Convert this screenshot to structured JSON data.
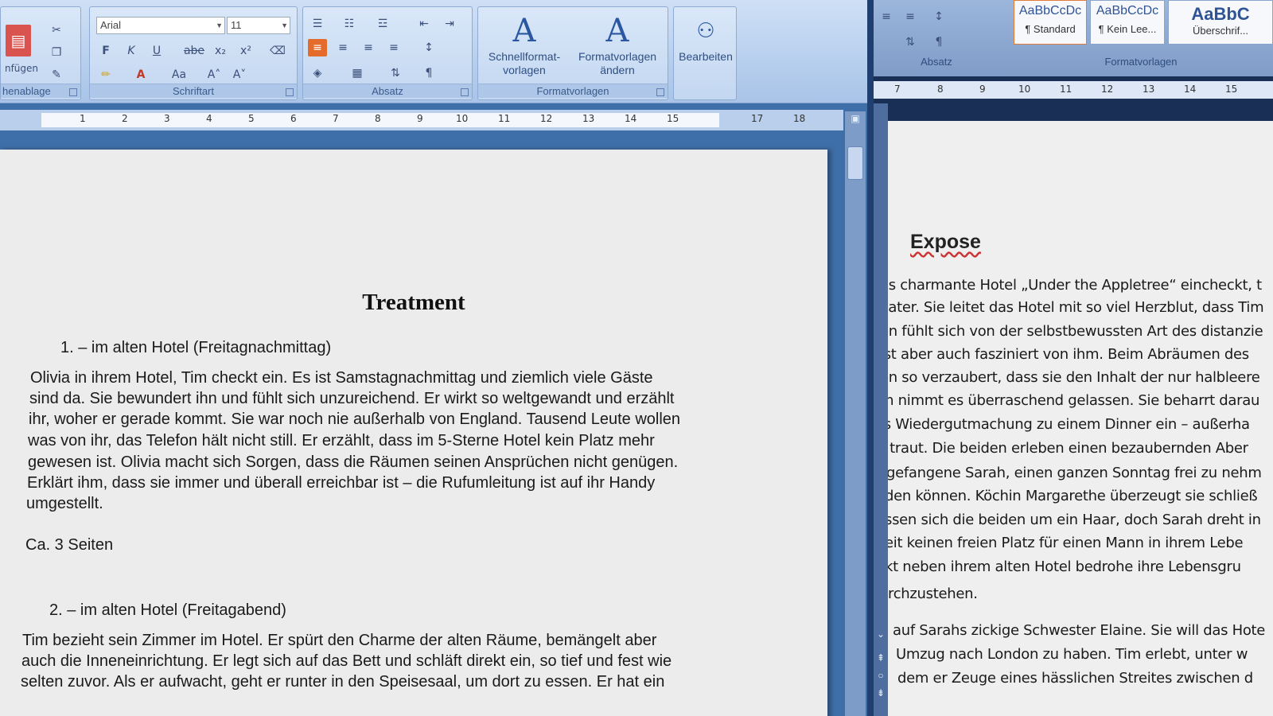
{
  "left_window": {
    "ribbon": {
      "clipboard": {
        "label": "henablage",
        "paste_label": "nfügen"
      },
      "font": {
        "label": "Schriftart",
        "font_name": "Arial",
        "font_size": "11",
        "buttons": [
          "F",
          "K",
          "U",
          "abe",
          "x₂",
          "x²",
          "A",
          "Aa",
          "A˄",
          "A˅"
        ]
      },
      "paragraph": {
        "label": "Absatz"
      },
      "styles": {
        "label": "Formatvorlagen",
        "quick_styles_label": "Schnellformat-\nvorlagen",
        "change_styles_label": "Formatvorlagen\nändern"
      },
      "editing": {
        "edit_label": "Bearbeiten"
      }
    },
    "ruler": {
      "ticks": [
        "1",
        "2",
        "3",
        "4",
        "5",
        "6",
        "7",
        "8",
        "9",
        "10",
        "11",
        "12",
        "13",
        "14",
        "15",
        "17",
        "18"
      ]
    },
    "document": {
      "title": "Treatment",
      "sections": [
        {
          "heading": "1.  – im alten Hotel (Freitagnachmittag)",
          "lines": [
            "Olivia in ihrem Hotel, Tim checkt ein. Es ist Samstagnachmittag und ziemlich viele Gäste",
            "sind da. Sie bewundert ihn und fühlt sich unzureichend. Er wirkt so weltgewandt und erzählt",
            "ihr, woher er gerade kommt. Sie war noch nie außerhalb von England. Tausend Leute wollen",
            "was von ihr, das Telefon hält nicht still. Er erzählt, dass im 5-Sterne Hotel kein Platz mehr",
            "gewesen ist. Olivia macht sich Sorgen, dass die Räumen seinen Ansprüchen nicht genügen.",
            "Erklärt ihm, dass sie immer und überall erreichbar ist – die Rufumleitung ist auf ihr Handy",
            "umgestellt."
          ],
          "note": "Ca. 3 Seiten"
        },
        {
          "heading": "2.  – im alten Hotel (Freitagabend)",
          "lines": [
            "Tim bezieht sein Zimmer im Hotel. Er spürt den Charme der alten Räume, bemängelt aber",
            "auch die Inneneinrichtung. Er legt sich auf das Bett und schläft direkt ein, so tief und fest wie",
            "selten zuvor. Als er aufwacht, geht er runter in den Speisesaal, um dort zu essen. Er hat ein"
          ]
        }
      ]
    }
  },
  "right_window": {
    "ribbon": {
      "paragraph_label": "Absatz",
      "styles_label": "Formatvorlagen",
      "style_tiles": [
        {
          "sample": "AaBbCcDc",
          "name": "¶ Standard"
        },
        {
          "sample": "AaBbCcDc",
          "name": "¶ Kein Lee..."
        },
        {
          "sample": "AaBbC",
          "name": "Überschrif..."
        }
      ]
    },
    "ruler": {
      "ticks": [
        "7",
        "8",
        "9",
        "10",
        "11",
        "12",
        "13",
        "14",
        "15"
      ]
    },
    "document": {
      "title": "Expose",
      "lines": [
        "as charmante Hotel „Under the Appletree“ eincheckt, t",
        "vater. Sie leitet das Hotel mit so viel Herzblut, dass Tim",
        "en fühlt sich von der selbstbewussten Art des distanzie",
        "ist aber auch fasziniert von ihm. Beim Abräumen des",
        "en so verzaubert, dass sie den Inhalt der nur halbleere",
        "m nimmt es überraschend gelassen. Sie beharrt darau",
        "ls Wiedergutmachung zu einem Dinner ein – außerha",
        "t traut. Die beiden erleben einen bezaubernden Aber",
        "gefangene Sarah, einen ganzen Sonntag frei zu nehm",
        "den können. Köchin Margarethe überzeugt sie schließ",
        "ssen sich die beiden um ein Haar, doch Sarah dreht in",
        "eit keinen freien Platz für einen Mann in ihrem Lebe",
        "kt neben ihrem alten Hotel bedrohe ihre Lebensgru",
        "rchzustehen.",
        "auf Sarahs zickige Schwester Elaine. Sie will das Hote",
        "Umzug nach London zu haben. Tim erlebt, unter w",
        "dem er Zeuge eines hässlichen Streites zwischen d"
      ]
    }
  }
}
